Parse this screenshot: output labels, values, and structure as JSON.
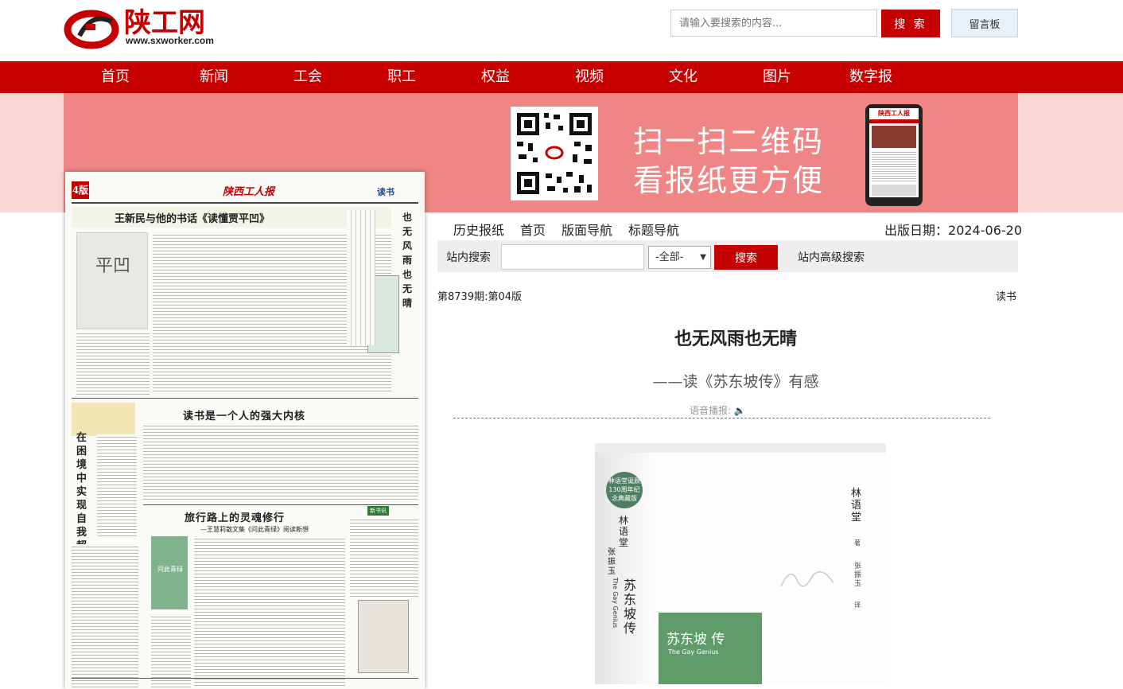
{
  "header": {
    "logo_text": "陕工网",
    "logo_url": "www.sxworker.com",
    "search_placeholder": "请输入要搜索的内容...",
    "search_button": "搜 索",
    "message_board": "留言板"
  },
  "nav": [
    "首页",
    "新闻",
    "工会",
    "职工",
    "权益",
    "视频",
    "文化",
    "图片",
    "数字报"
  ],
  "banner": {
    "line1": "扫一扫二维码",
    "line2": "看报纸更方便"
  },
  "paper_page": {
    "page_no": "4版",
    "masthead": "陕西工人报",
    "section": "读书",
    "headline1": "王新民与他的书话《读懂贾平凹》",
    "headline2": "读书是一个人的强大内核",
    "headline3": "旅行路上的灵魂修行",
    "subhead3": "—王慧莉散文集《问此青绿》阅读断想",
    "vertical_title": "也无风雨也无晴",
    "left_vertical": "在困境中实现自我超越",
    "mini_book_title": "平凹",
    "mini_book2": "问此青绿",
    "new_book_tag": "新书讯"
  },
  "reader": {
    "tabs": [
      "历史报纸",
      "首页",
      "版面导航",
      "标题导航"
    ],
    "pub_date_label": "出版日期：",
    "pub_date": "2024-06-20",
    "site_search_label": "站内搜索",
    "site_select": "-全部-",
    "site_search_button": "搜索",
    "advanced_search": "站内高级搜索",
    "issue": "第8739期:第04版",
    "section": "读书",
    "title": "也无风雨也无晴",
    "subtitle": "——读《苏东坡传》有感",
    "voice_label": "语音播报:"
  },
  "book": {
    "author": "林语堂",
    "author_mark": "著",
    "translator": "张振玉",
    "translator_mark": "译",
    "title_cn": "苏东坡传",
    "title_en": "The Gay Genius",
    "cover_title": "苏东坡 传",
    "cover_en": "The Gay Genius",
    "badge": "林语堂诞辰130周年纪念典藏版"
  },
  "colors": {
    "nav_red": "#c80000",
    "button_red": "#c40000",
    "banner_pink": "#f08585",
    "banner_side": "#f9d7d7",
    "book_green": "#5f9c6a"
  }
}
